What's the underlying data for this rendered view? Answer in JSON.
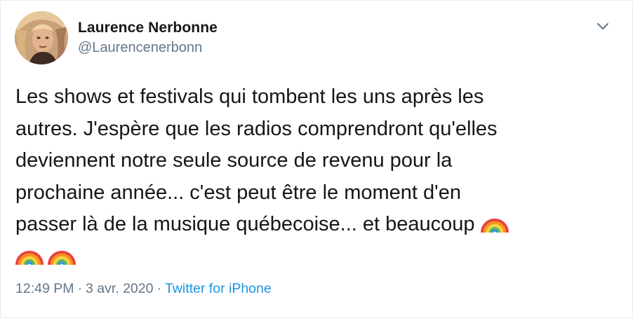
{
  "user": {
    "display_name": "Laurence Nerbonne",
    "handle": "@Laurencenerbonn"
  },
  "tweet": {
    "lines": [
      "Les shows et festivals qui tombent les uns après les",
      "autres. J'espère que les radios comprendront qu'elles",
      "deviennent notre seule source de revenu pour la",
      "prochaine année... c'est peut être le moment d'en",
      "passer là de la musique québecoise... et beaucoup"
    ],
    "emoji": [
      "rainbow-emoji",
      "rainbow-emoji",
      "rainbow-emoji"
    ]
  },
  "meta": {
    "time": "12:49 PM",
    "separator_1": "·",
    "date": "3 avr. 2020",
    "separator_2": "·",
    "source": "Twitter for iPhone"
  },
  "colors": {
    "text": "#14171a",
    "secondary": "#657786",
    "link": "#1b95e0",
    "border": "#e6ecf0"
  },
  "icons": {
    "menu": "chevron-down-icon"
  }
}
